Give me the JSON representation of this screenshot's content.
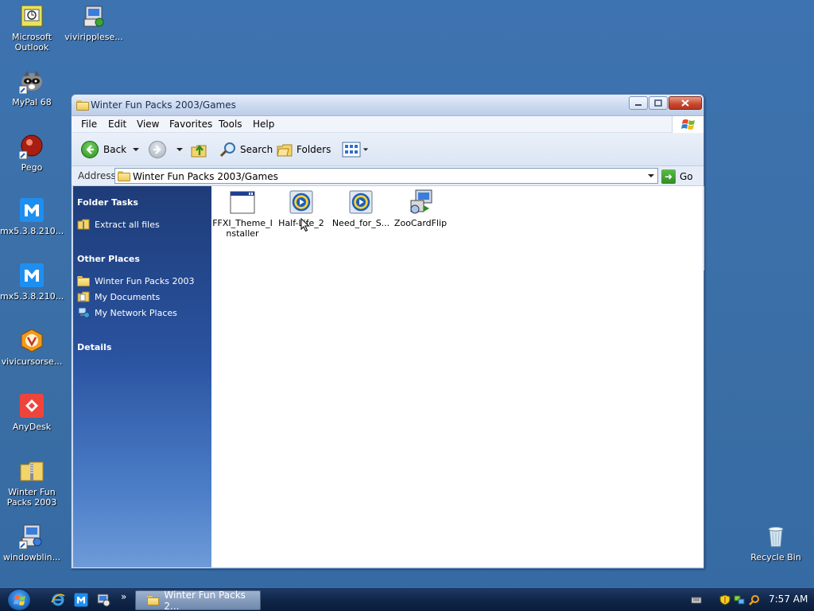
{
  "desktop": {
    "icons": [
      {
        "label": "Microsoft Outlook"
      },
      {
        "label": "viviripplese..."
      },
      {
        "label": "MyPal 68"
      },
      {
        "label": "Pego"
      },
      {
        "label": "mx5.3.8.210..."
      },
      {
        "label": "mx5.3.8.210..."
      },
      {
        "label": "vivicursorse..."
      },
      {
        "label": "AnyDesk"
      },
      {
        "label": "Winter Fun Packs 2003"
      },
      {
        "label": "windowblin..."
      },
      {
        "label": "Recycle Bin"
      }
    ]
  },
  "window": {
    "title": "Winter Fun Packs 2003/Games",
    "menu": [
      "File",
      "Edit",
      "View",
      "Favorites",
      "Tools",
      "Help"
    ],
    "toolbar": {
      "back": "Back",
      "search": "Search",
      "folders": "Folders"
    },
    "address": {
      "label": "Address",
      "value": "Winter Fun Packs 2003/Games",
      "go": "Go"
    },
    "sidebar": {
      "folder_tasks": {
        "title": "Folder Tasks",
        "items": [
          "Extract all files"
        ]
      },
      "other_places": {
        "title": "Other Places",
        "items": [
          "Winter Fun Packs 2003",
          "My Documents",
          "My Network Places"
        ]
      },
      "details": {
        "title": "Details"
      }
    },
    "files": [
      {
        "name": "FFXI_Theme_Installer",
        "icon": "window-app-icon"
      },
      {
        "name": "Half-Life_2",
        "icon": "media-file-icon"
      },
      {
        "name": "Need_for_S...",
        "icon": "media-file-icon"
      },
      {
        "name": "ZooCardFlip",
        "icon": "installer-icon"
      }
    ]
  },
  "taskbar": {
    "task_button": "Winter Fun Packs 2...",
    "clock": "7:57 AM",
    "overflow": "»"
  },
  "colors": {
    "desktop": "#3a6ea5",
    "sidebar_top": "#1e3c78",
    "sidebar_bottom": "#6e9bd8",
    "taskbar": "#11274a"
  }
}
